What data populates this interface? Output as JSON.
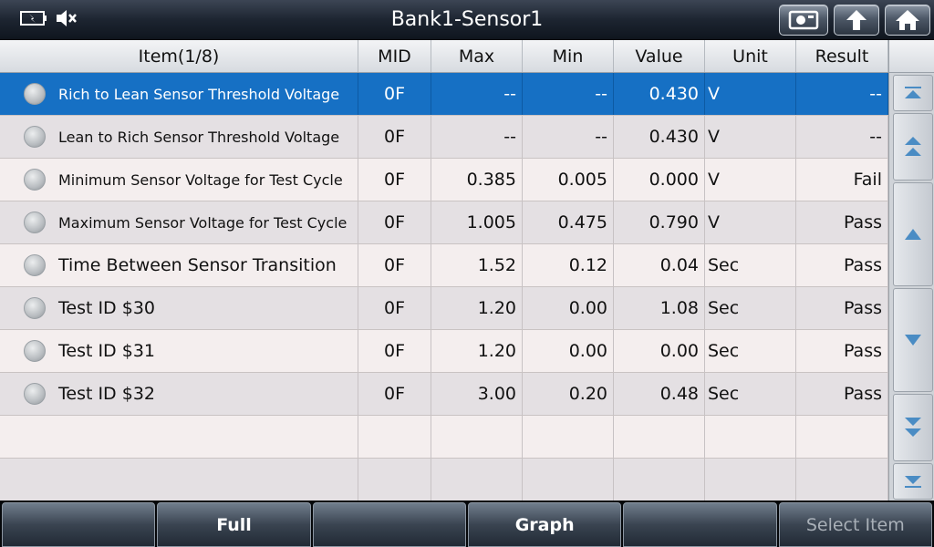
{
  "header": {
    "title": "Bank1-Sensor1",
    "status_icons": [
      "battery-icon",
      "mute-icon"
    ],
    "buttons": [
      "screenshot-icon",
      "back-icon",
      "home-icon"
    ]
  },
  "table": {
    "columns": {
      "item": "Item(1/8)",
      "mid": "MID",
      "max": "Max",
      "min": "Min",
      "value": "Value",
      "unit": "Unit",
      "result": "Result"
    },
    "rows": [
      {
        "item": "Rich to Lean Sensor Threshold Voltage",
        "mid": "0F",
        "max": "--",
        "min": "--",
        "value": "0.430",
        "unit": "V",
        "result": "--"
      },
      {
        "item": "Lean to Rich Sensor Threshold Voltage",
        "mid": "0F",
        "max": "--",
        "min": "--",
        "value": "0.430",
        "unit": "V",
        "result": "--"
      },
      {
        "item": "Minimum Sensor Voltage for Test Cycle",
        "mid": "0F",
        "max": "0.385",
        "min": "0.005",
        "value": "0.000",
        "unit": "V",
        "result": "Fail"
      },
      {
        "item": "Maximum Sensor Voltage for Test Cycle",
        "mid": "0F",
        "max": "1.005",
        "min": "0.475",
        "value": "0.790",
        "unit": "V",
        "result": "Pass"
      },
      {
        "item": "Time Between Sensor Transition",
        "mid": "0F",
        "max": "1.52",
        "min": "0.12",
        "value": "0.04",
        "unit": "Sec",
        "result": "Pass"
      },
      {
        "item": "Test ID $30",
        "mid": "0F",
        "max": "1.20",
        "min": "0.00",
        "value": "1.08",
        "unit": "Sec",
        "result": "Pass"
      },
      {
        "item": "Test ID $31",
        "mid": "0F",
        "max": "1.20",
        "min": "0.00",
        "value": "0.00",
        "unit": "Sec",
        "result": "Pass"
      },
      {
        "item": "Test ID $32",
        "mid": "0F",
        "max": "3.00",
        "min": "0.20",
        "value": "0.48",
        "unit": "Sec",
        "result": "Pass"
      }
    ],
    "selected_row": 0
  },
  "scroll_buttons": [
    "scroll-top-icon",
    "page-up-icon",
    "line-up-icon",
    "line-down-icon",
    "page-down-icon",
    "scroll-bottom-icon"
  ],
  "toolbar": {
    "buttons": [
      "",
      "Full",
      "",
      "Graph",
      "",
      "Select Item"
    ]
  },
  "colors": {
    "selected_row": "#1670c4",
    "title_bar": "#1d2531"
  }
}
